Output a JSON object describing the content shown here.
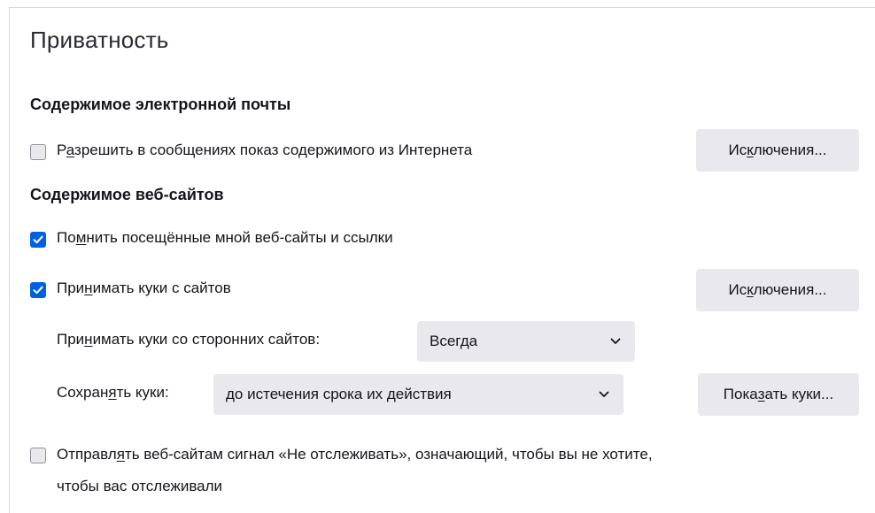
{
  "page": {
    "title": "Приватность"
  },
  "email_content": {
    "heading": "Содержимое электронной почты",
    "allow_remote": {
      "label_before": "Р",
      "label_accesskey": "а",
      "label_after": "зрешить в сообщениях показ содержимого из Интернета",
      "checked": false
    },
    "exceptions_button": {
      "before": "Ис",
      "accesskey": "к",
      "after": "лючения..."
    }
  },
  "web_content": {
    "heading": "Содержимое веб-сайтов",
    "remember_history": {
      "label_before": "По",
      "label_accesskey": "м",
      "label_after": "нить посещённые мной веб-сайты и ссылки",
      "checked": true
    },
    "accept_cookies": {
      "label_before": "При",
      "label_accesskey": "н",
      "label_after": "имать куки с сайтов",
      "checked": true
    },
    "cookie_exceptions_button": {
      "before": "Ис",
      "accesskey": "к",
      "after": "лючения..."
    },
    "third_party": {
      "label_before": "При",
      "label_accesskey": "н",
      "label_after": "имать куки со сторонних сайтов:",
      "selected": "Всегда"
    },
    "keep_cookies": {
      "label_before": "Сохран",
      "label_accesskey": "я",
      "label_after": "ть куки:",
      "selected": "до истечения срока их действия"
    },
    "show_cookies_button": {
      "before": "Пока",
      "accesskey": "з",
      "after": "ать куки..."
    },
    "do_not_track": {
      "line1_before": "Отправл",
      "line1_accesskey": "я",
      "line1_after": "ть веб-сайтам сигнал «Не отслеживать», означающий, чтобы вы не хотите,",
      "line2": "чтобы вас отслеживали",
      "checked": false
    }
  },
  "colors": {
    "accent": "#0061e0",
    "button_bg": "#e9e9ed",
    "text": "#15141a"
  },
  "icons": {
    "check": "check-icon",
    "dropdown": "chevron-down-icon"
  }
}
